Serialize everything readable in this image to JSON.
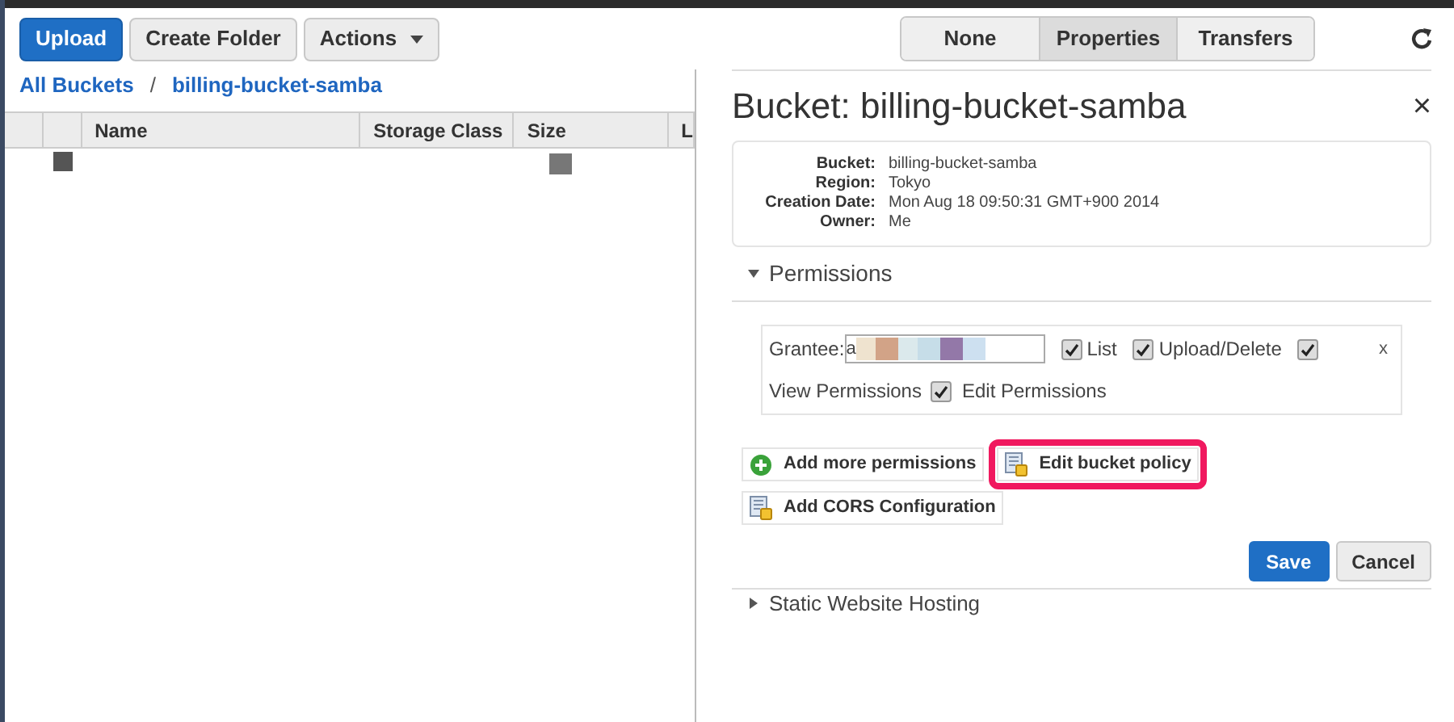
{
  "toolbar": {
    "buttons": [
      {
        "label": "Upload",
        "kind": "primary"
      },
      {
        "label": "Create Folder",
        "kind": "plain"
      },
      {
        "label": "Actions",
        "kind": "dropdown"
      }
    ]
  },
  "view_tabs": [
    {
      "label": "None",
      "selected": false
    },
    {
      "label": "Properties",
      "selected": true
    },
    {
      "label": "Transfers",
      "selected": false
    }
  ],
  "breadcrumb": [
    "All Buckets",
    "/",
    "billing-bucket-samba"
  ],
  "table": {
    "columns": [
      "Name",
      "Storage Class",
      "Size",
      "L"
    ],
    "rows": [
      {
        "kind": "redacted"
      }
    ]
  },
  "panel": {
    "title": "Bucket: billing-bucket-samba",
    "close": "×",
    "details": [
      {
        "label": "Bucket:",
        "value": "billing-bucket-samba"
      },
      {
        "label": "Region:",
        "value": "Tokyo"
      },
      {
        "label": "Creation Date:",
        "value": "Mon Aug 18 09:50:31 GMT+900 2014"
      },
      {
        "label": "Owner:",
        "value": "Me"
      }
    ],
    "permissions": {
      "title": "Permissions",
      "expanded": true,
      "grantee_label": "Grantee:",
      "grantee_prefix": "a",
      "checks": [
        {
          "label": "List",
          "checked": true
        },
        {
          "label": "Upload/Delete",
          "checked": true
        },
        {
          "checked": true
        }
      ],
      "view_label": "View Permissions",
      "edit": {
        "label": "Edit Permissions",
        "checked": true
      },
      "remove": "x"
    },
    "actions": [
      {
        "label": "Add more permissions",
        "kind": "add",
        "highlighted": false
      },
      {
        "label": "Edit bucket policy",
        "kind": "policy",
        "highlighted": true
      },
      {
        "label": "Add CORS Configuration",
        "kind": "policy",
        "highlighted": false
      }
    ],
    "save": "Save",
    "cancel": "Cancel",
    "next_section": {
      "title": "Static Website Hosting",
      "expanded": false
    }
  }
}
